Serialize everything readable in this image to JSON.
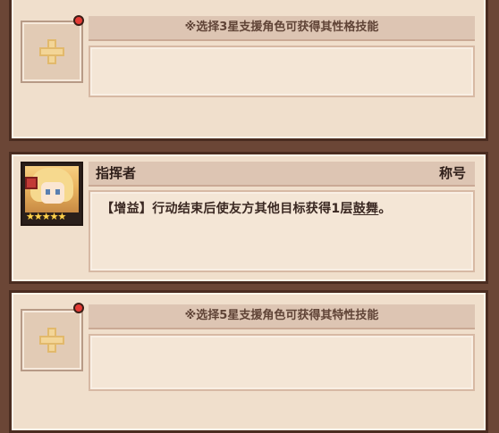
{
  "slots": [
    {
      "header_hint": "※选择3星支援角色可获得其性格技能",
      "empty_slot_icon": "plus-icon",
      "has_red_dot": true
    },
    {
      "title": "指挥者",
      "tag": "称号",
      "avatar_stars": "★★★★★",
      "description_prefix": "【增益】行动结束后使友方其他目标获得1层",
      "description_keyword": "鼓舞",
      "description_suffix": "。"
    },
    {
      "header_hint": "※选择5星支援角色可获得其特性技能",
      "empty_slot_icon": "plus-icon",
      "has_red_dot": true
    }
  ],
  "colors": {
    "frame_brown": "#6b4636",
    "panel_bg": "#f0dfcc",
    "header_bg": "#ddc5b3",
    "red_dot": "#e43b35",
    "plus_yellow": "#f3d597"
  }
}
